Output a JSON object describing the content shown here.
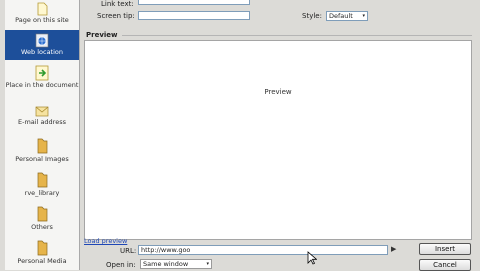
{
  "sidebar": {
    "items": [
      {
        "label": "Page on this site",
        "icon": "page-icon"
      },
      {
        "label": "Web location",
        "icon": "globe-icon"
      },
      {
        "label": "Place in the document",
        "icon": "anchor-page-icon"
      },
      {
        "label": "E-mail address",
        "icon": "envelope-icon"
      },
      {
        "label": "Personal Images",
        "icon": "folder-icon"
      },
      {
        "label": "rve_library",
        "icon": "folder-icon"
      },
      {
        "label": "Others",
        "icon": "folder-icon"
      },
      {
        "label": "Personal Media",
        "icon": "folder-icon"
      }
    ],
    "selected_index": 1
  },
  "fields": {
    "link_text_label": "Link text:",
    "screen_tip_label": "Screen tip:",
    "style_label": "Style:",
    "style_value": "Default"
  },
  "preview": {
    "section_title": "Preview",
    "placeholder_text": "Preview"
  },
  "bottom": {
    "load_preview_link": "Load preview",
    "url_label": "URL:",
    "url_value": "http://www.goo",
    "open_in_label": "Open in:",
    "open_in_value": "Same window",
    "insert_button": "Insert",
    "cancel_button": "Cancel"
  },
  "colors": {
    "selection": "#1d4f9a",
    "link": "#1f47b6",
    "input_border": "#7f9db9"
  }
}
